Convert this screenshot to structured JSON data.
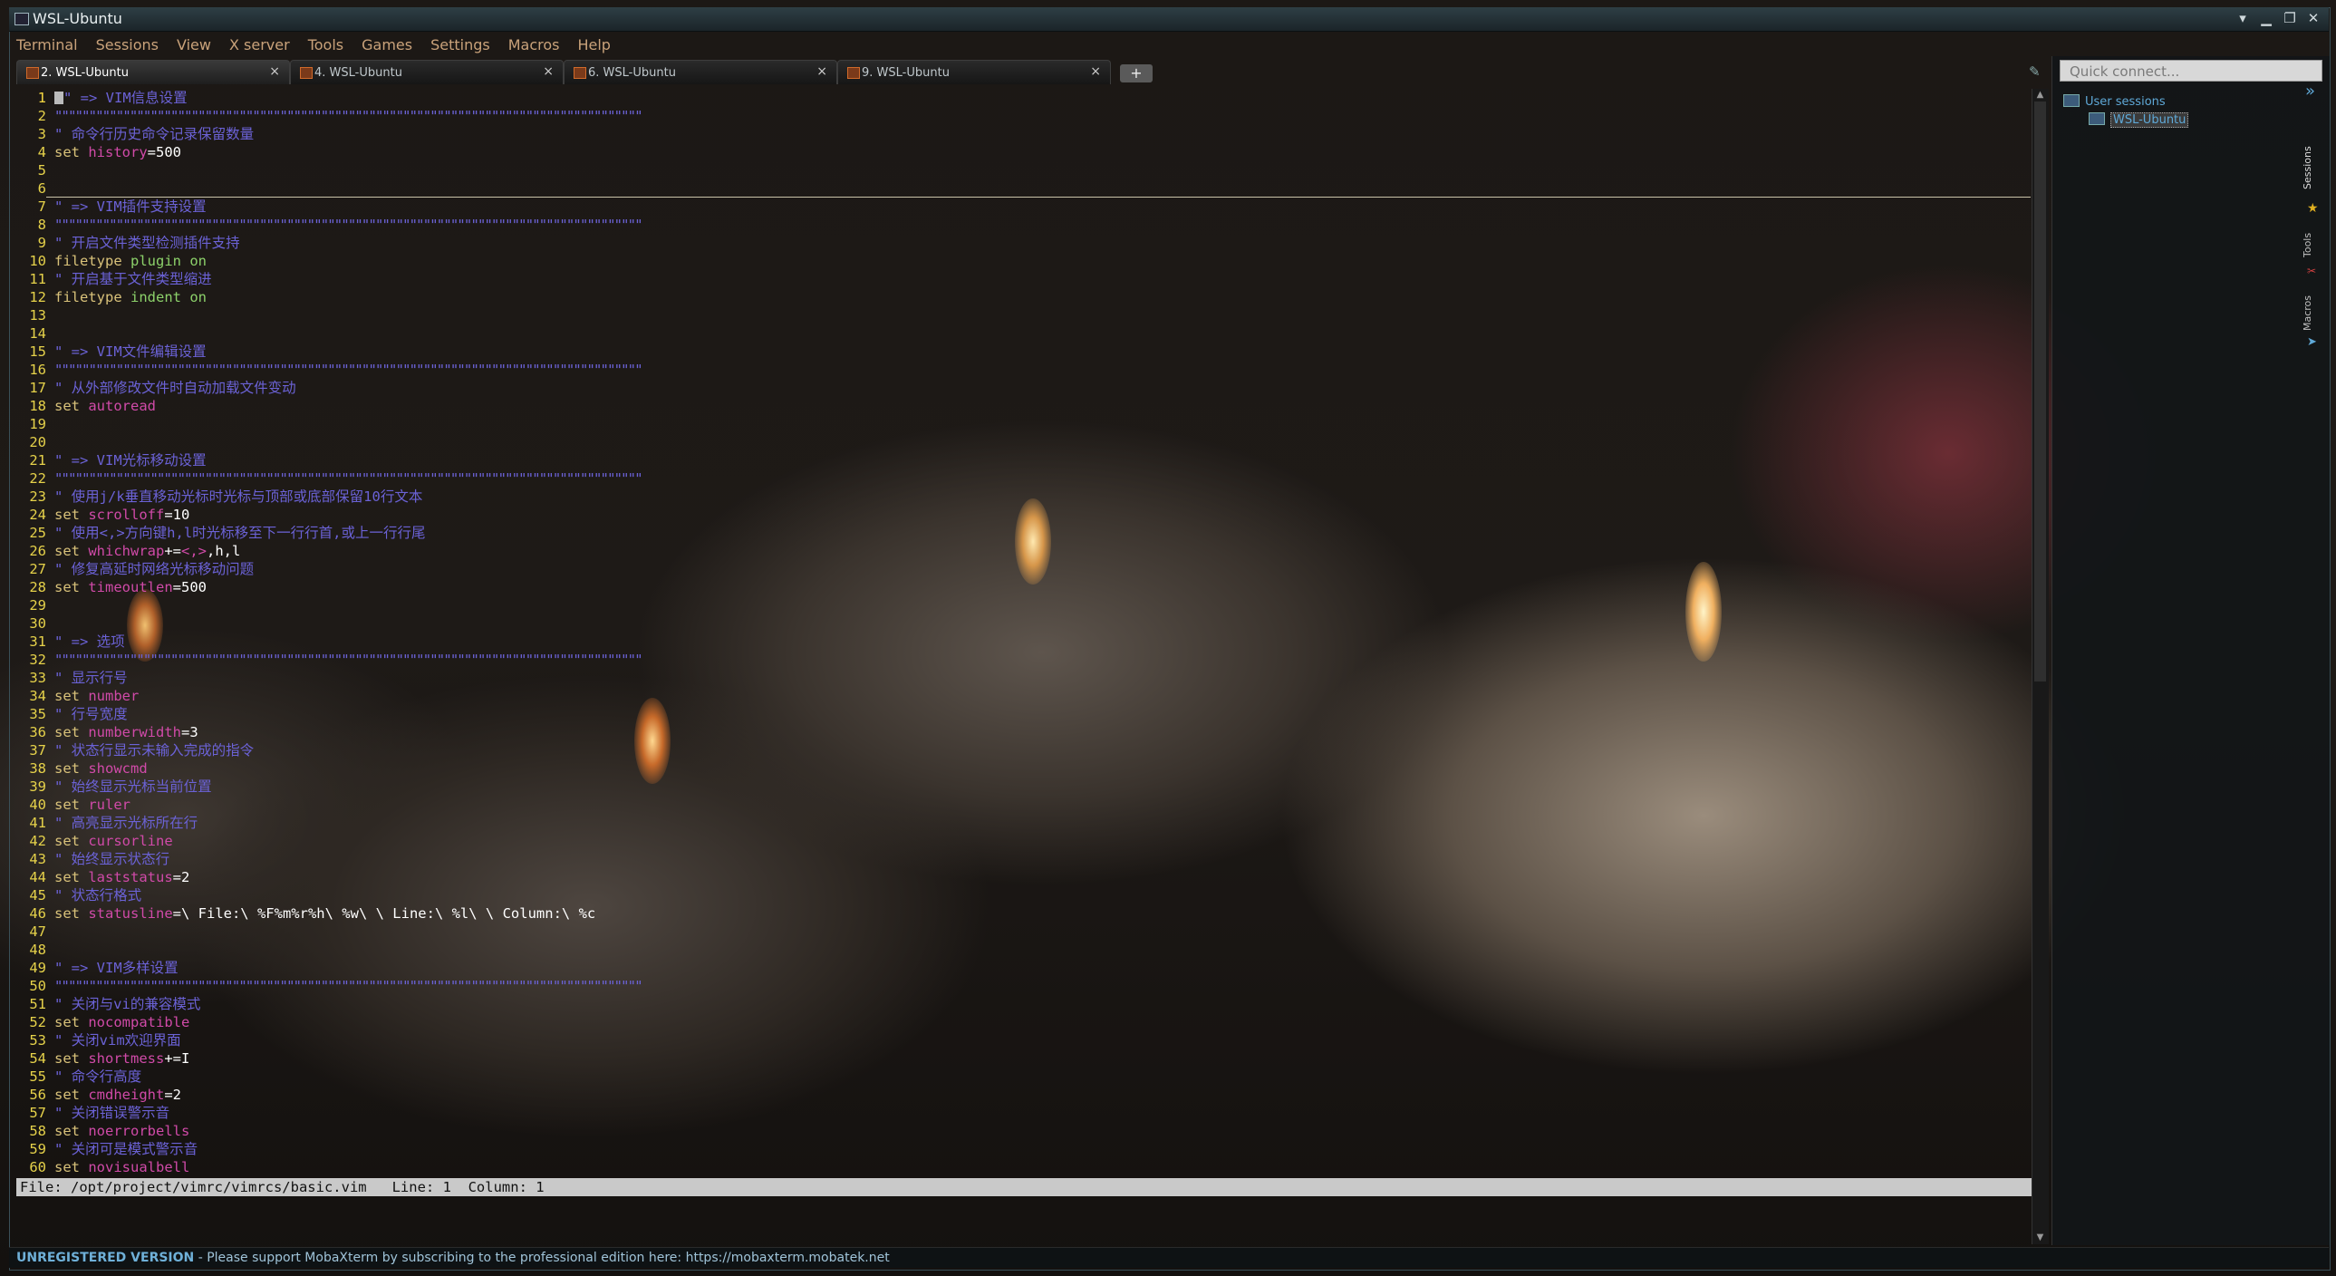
{
  "window": {
    "title": "WSL-Ubuntu",
    "controls": [
      "▾",
      "▁",
      "❐",
      "✕"
    ]
  },
  "menu": [
    "Terminal",
    "Sessions",
    "View",
    "X server",
    "Tools",
    "Games",
    "Settings",
    "Macros",
    "Help"
  ],
  "tabs": [
    {
      "label": "2. WSL-Ubuntu",
      "active": true
    },
    {
      "label": "4. WSL-Ubuntu",
      "active": false
    },
    {
      "label": "6. WSL-Ubuntu",
      "active": false
    },
    {
      "label": "9. WSL-Ubuntu",
      "active": false
    }
  ],
  "tab_close": "×",
  "new_tab": "+",
  "editor": {
    "lines": [
      {
        "n": "1",
        "segs": [
          {
            "c": "cursor",
            "t": ""
          },
          {
            "c": "cmt",
            "t": "\" => VIM信息设置"
          }
        ]
      },
      {
        "n": "2",
        "segs": [
          {
            "c": "sep",
            "t": "\"\"\"\"\"\"\"\"\"\"\"\"\"\"\"\"\"\"\"\"\"\"\"\"\"\"\"\"\"\"\"\"\"\"\"\"\"\"\"\"\"\"\"\"\"\"\"\"\"\"\"\"\"\"\"\"\"\"\"\"\"\"\"\"\"\"\"\"\"\"\"\"\"\"\"\"\"\"\"\"\"\"\"\"\"\""
          }
        ]
      },
      {
        "n": "3",
        "segs": [
          {
            "c": "cmt",
            "t": "\" 命令行历史命令记录保留数量"
          }
        ]
      },
      {
        "n": "4",
        "segs": [
          {
            "c": "kw",
            "t": "set "
          },
          {
            "c": "opt",
            "t": "history"
          },
          {
            "c": "val",
            "t": "=500"
          }
        ]
      },
      {
        "n": "5",
        "segs": []
      },
      {
        "n": "6",
        "segs": []
      },
      {
        "n": "7",
        "segs": [
          {
            "c": "cmt",
            "t": "\" => VIM插件支持设置"
          }
        ]
      },
      {
        "n": "8",
        "segs": [
          {
            "c": "sep",
            "t": "\"\"\"\"\"\"\"\"\"\"\"\"\"\"\"\"\"\"\"\"\"\"\"\"\"\"\"\"\"\"\"\"\"\"\"\"\"\"\"\"\"\"\"\"\"\"\"\"\"\"\"\"\"\"\"\"\"\"\"\"\"\"\"\"\"\"\"\"\"\"\"\"\"\"\"\"\"\"\"\"\"\"\"\"\"\""
          }
        ]
      },
      {
        "n": "9",
        "segs": [
          {
            "c": "cmt",
            "t": "\" 开启文件类型检测插件支持"
          }
        ]
      },
      {
        "n": "10",
        "segs": [
          {
            "c": "kw",
            "t": "filetype "
          },
          {
            "c": "arg",
            "t": "plugin on"
          }
        ]
      },
      {
        "n": "11",
        "segs": [
          {
            "c": "cmt",
            "t": "\" 开启基于文件类型缩进"
          }
        ]
      },
      {
        "n": "12",
        "segs": [
          {
            "c": "kw",
            "t": "filetype "
          },
          {
            "c": "arg",
            "t": "indent on"
          }
        ]
      },
      {
        "n": "13",
        "segs": []
      },
      {
        "n": "14",
        "segs": []
      },
      {
        "n": "15",
        "segs": [
          {
            "c": "cmt",
            "t": "\" => VIM文件编辑设置"
          }
        ]
      },
      {
        "n": "16",
        "segs": [
          {
            "c": "sep",
            "t": "\"\"\"\"\"\"\"\"\"\"\"\"\"\"\"\"\"\"\"\"\"\"\"\"\"\"\"\"\"\"\"\"\"\"\"\"\"\"\"\"\"\"\"\"\"\"\"\"\"\"\"\"\"\"\"\"\"\"\"\"\"\"\"\"\"\"\"\"\"\"\"\"\"\"\"\"\"\"\"\"\"\"\"\"\"\""
          }
        ]
      },
      {
        "n": "17",
        "segs": [
          {
            "c": "cmt",
            "t": "\" 从外部修改文件时自动加载文件变动"
          }
        ]
      },
      {
        "n": "18",
        "segs": [
          {
            "c": "kw",
            "t": "set "
          },
          {
            "c": "opt",
            "t": "autoread"
          }
        ]
      },
      {
        "n": "19",
        "segs": []
      },
      {
        "n": "20",
        "segs": []
      },
      {
        "n": "21",
        "segs": [
          {
            "c": "cmt",
            "t": "\" => VIM光标移动设置"
          }
        ]
      },
      {
        "n": "22",
        "segs": [
          {
            "c": "sep",
            "t": "\"\"\"\"\"\"\"\"\"\"\"\"\"\"\"\"\"\"\"\"\"\"\"\"\"\"\"\"\"\"\"\"\"\"\"\"\"\"\"\"\"\"\"\"\"\"\"\"\"\"\"\"\"\"\"\"\"\"\"\"\"\"\"\"\"\"\"\"\"\"\"\"\"\"\"\"\"\"\"\"\"\"\"\"\"\""
          }
        ]
      },
      {
        "n": "23",
        "segs": [
          {
            "c": "cmt",
            "t": "\" 使用j/k垂直移动光标时光标与顶部或底部保留10行文本"
          }
        ]
      },
      {
        "n": "24",
        "segs": [
          {
            "c": "kw",
            "t": "set "
          },
          {
            "c": "opt",
            "t": "scrolloff"
          },
          {
            "c": "val",
            "t": "=10"
          }
        ]
      },
      {
        "n": "25",
        "segs": [
          {
            "c": "cmt",
            "t": "\" 使用<,>方向键h,l时光标移至下一行行首,或上一行行尾"
          }
        ]
      },
      {
        "n": "26",
        "segs": [
          {
            "c": "kw",
            "t": "set "
          },
          {
            "c": "opt",
            "t": "whichwrap"
          },
          {
            "c": "val",
            "t": "+="
          },
          {
            "c": "opt",
            "t": "<,>"
          },
          {
            "c": "val",
            "t": ",h,l"
          }
        ]
      },
      {
        "n": "27",
        "segs": [
          {
            "c": "cmt",
            "t": "\" 修复高延时网络光标移动问题"
          }
        ]
      },
      {
        "n": "28",
        "segs": [
          {
            "c": "kw",
            "t": "set "
          },
          {
            "c": "opt",
            "t": "timeoutlen"
          },
          {
            "c": "val",
            "t": "=500"
          }
        ]
      },
      {
        "n": "29",
        "segs": []
      },
      {
        "n": "30",
        "segs": []
      },
      {
        "n": "31",
        "segs": [
          {
            "c": "cmt",
            "t": "\" => 选项"
          }
        ]
      },
      {
        "n": "32",
        "segs": [
          {
            "c": "sep",
            "t": "\"\"\"\"\"\"\"\"\"\"\"\"\"\"\"\"\"\"\"\"\"\"\"\"\"\"\"\"\"\"\"\"\"\"\"\"\"\"\"\"\"\"\"\"\"\"\"\"\"\"\"\"\"\"\"\"\"\"\"\"\"\"\"\"\"\"\"\"\"\"\"\"\"\"\"\"\"\"\"\"\"\"\"\"\"\""
          }
        ]
      },
      {
        "n": "33",
        "segs": [
          {
            "c": "cmt",
            "t": "\" 显示行号"
          }
        ]
      },
      {
        "n": "34",
        "segs": [
          {
            "c": "kw",
            "t": "set "
          },
          {
            "c": "opt",
            "t": "number"
          }
        ]
      },
      {
        "n": "35",
        "segs": [
          {
            "c": "cmt",
            "t": "\" 行号宽度"
          }
        ]
      },
      {
        "n": "36",
        "segs": [
          {
            "c": "kw",
            "t": "set "
          },
          {
            "c": "opt",
            "t": "numberwidth"
          },
          {
            "c": "val",
            "t": "=3"
          }
        ]
      },
      {
        "n": "37",
        "segs": [
          {
            "c": "cmt",
            "t": "\" 状态行显示未输入完成的指令"
          }
        ]
      },
      {
        "n": "38",
        "segs": [
          {
            "c": "kw",
            "t": "set "
          },
          {
            "c": "opt",
            "t": "showcmd"
          }
        ]
      },
      {
        "n": "39",
        "segs": [
          {
            "c": "cmt",
            "t": "\" 始终显示光标当前位置"
          }
        ]
      },
      {
        "n": "40",
        "segs": [
          {
            "c": "kw",
            "t": "set "
          },
          {
            "c": "opt",
            "t": "ruler"
          }
        ]
      },
      {
        "n": "41",
        "segs": [
          {
            "c": "cmt",
            "t": "\" 高亮显示光标所在行"
          }
        ]
      },
      {
        "n": "42",
        "segs": [
          {
            "c": "kw",
            "t": "set "
          },
          {
            "c": "opt",
            "t": "cursorline"
          }
        ]
      },
      {
        "n": "43",
        "segs": [
          {
            "c": "cmt",
            "t": "\" 始终显示状态行"
          }
        ]
      },
      {
        "n": "44",
        "segs": [
          {
            "c": "kw",
            "t": "set "
          },
          {
            "c": "opt",
            "t": "laststatus"
          },
          {
            "c": "val",
            "t": "=2"
          }
        ]
      },
      {
        "n": "45",
        "segs": [
          {
            "c": "cmt",
            "t": "\" 状态行格式"
          }
        ]
      },
      {
        "n": "46",
        "segs": [
          {
            "c": "kw",
            "t": "set "
          },
          {
            "c": "opt",
            "t": "statusline"
          },
          {
            "c": "val",
            "t": "=\\ File:\\ %F%m%r%h\\ %w\\ \\ Line:\\ %l\\ \\ Column:\\ %c"
          }
        ]
      },
      {
        "n": "47",
        "segs": []
      },
      {
        "n": "48",
        "segs": []
      },
      {
        "n": "49",
        "segs": [
          {
            "c": "cmt",
            "t": "\" => VIM多样设置"
          }
        ]
      },
      {
        "n": "50",
        "segs": [
          {
            "c": "sep",
            "t": "\"\"\"\"\"\"\"\"\"\"\"\"\"\"\"\"\"\"\"\"\"\"\"\"\"\"\"\"\"\"\"\"\"\"\"\"\"\"\"\"\"\"\"\"\"\"\"\"\"\"\"\"\"\"\"\"\"\"\"\"\"\"\"\"\"\"\"\"\"\"\"\"\"\"\"\"\"\"\"\"\"\"\"\"\"\""
          }
        ]
      },
      {
        "n": "51",
        "segs": [
          {
            "c": "cmt",
            "t": "\" 关闭与vi的兼容模式"
          }
        ]
      },
      {
        "n": "52",
        "segs": [
          {
            "c": "kw",
            "t": "set "
          },
          {
            "c": "opt",
            "t": "nocompatible"
          }
        ]
      },
      {
        "n": "53",
        "segs": [
          {
            "c": "cmt",
            "t": "\" 关闭vim欢迎界面"
          }
        ]
      },
      {
        "n": "54",
        "segs": [
          {
            "c": "kw",
            "t": "set "
          },
          {
            "c": "opt",
            "t": "shortmess"
          },
          {
            "c": "val",
            "t": "+=I"
          }
        ]
      },
      {
        "n": "55",
        "segs": [
          {
            "c": "cmt",
            "t": "\" 命令行高度"
          }
        ]
      },
      {
        "n": "56",
        "segs": [
          {
            "c": "kw",
            "t": "set "
          },
          {
            "c": "opt",
            "t": "cmdheight"
          },
          {
            "c": "val",
            "t": "=2"
          }
        ]
      },
      {
        "n": "57",
        "segs": [
          {
            "c": "cmt",
            "t": "\" 关闭错误警示音"
          }
        ]
      },
      {
        "n": "58",
        "segs": [
          {
            "c": "kw",
            "t": "set "
          },
          {
            "c": "opt",
            "t": "noerrorbells"
          }
        ]
      },
      {
        "n": "59",
        "segs": [
          {
            "c": "cmt",
            "t": "\" 关闭可是模式警示音"
          }
        ]
      },
      {
        "n": "60",
        "segs": [
          {
            "c": "kw",
            "t": "set "
          },
          {
            "c": "opt",
            "t": "novisualbell"
          }
        ]
      }
    ],
    "statusline": "File: /opt/project/vimrc/vimrcs/basic.vim   Line: 1  Column: 1"
  },
  "sidebar": {
    "quick_connect_placeholder": "Quick connect...",
    "root": "User sessions",
    "session": "WSL-Ubuntu",
    "vtabs": [
      "Sessions",
      "Tools",
      "Macros"
    ]
  },
  "footer": {
    "unregistered": "UNREGISTERED VERSION",
    "message": "  -  Please support MobaXterm by subscribing to the professional edition here:  https://mobaxterm.mobatek.net"
  },
  "colors": {
    "comment": "#6b62d6",
    "keyword": "#d9c27a",
    "option": "#d04aa8",
    "line_number": "#e6d24a",
    "menu": "#c9a27a"
  }
}
